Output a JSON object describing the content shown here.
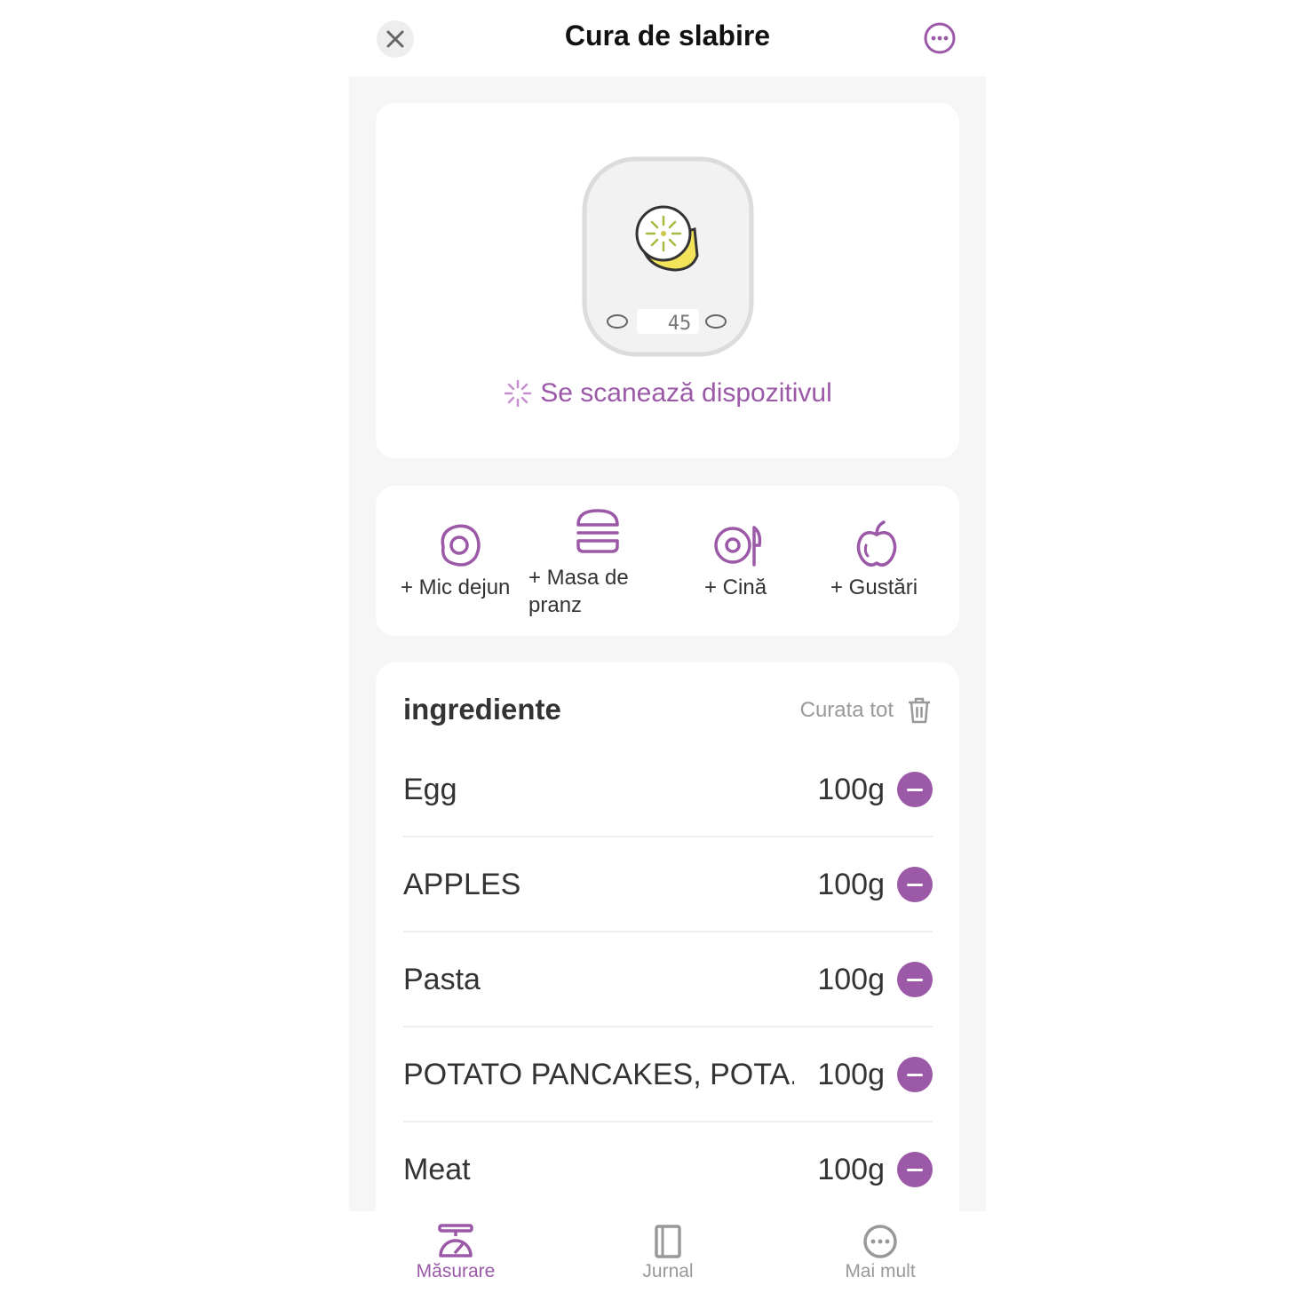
{
  "header": {
    "title": "Cura de slabire"
  },
  "scale": {
    "display_value": "45",
    "status": "Se scanează dispozitivul"
  },
  "meals": [
    {
      "label": "+ Mic dejun",
      "icon": "egg-icon"
    },
    {
      "label": "+ Masa de pranz",
      "icon": "burger-icon"
    },
    {
      "label": "+ Cină",
      "icon": "plate-icon"
    },
    {
      "label": "+ Gustări",
      "icon": "apple-icon"
    }
  ],
  "ingredients": {
    "title": "ingrediente",
    "clear_label": "Curata tot",
    "items": [
      {
        "name": "Egg",
        "amount": "100g"
      },
      {
        "name": "APPLES",
        "amount": "100g"
      },
      {
        "name": "Pasta",
        "amount": "100g"
      },
      {
        "name": "POTATO PANCAKES, POTA...",
        "amount": "100g"
      },
      {
        "name": "Meat",
        "amount": "100g"
      }
    ]
  },
  "tabs": [
    {
      "label": "Măsurare",
      "icon": "scale-icon",
      "active": true
    },
    {
      "label": "Jurnal",
      "icon": "journal-icon",
      "active": false
    },
    {
      "label": "Mai mult",
      "icon": "more-icon",
      "active": false
    }
  ],
  "colors": {
    "accent": "#9b59a8",
    "background": "#f6f6f7"
  }
}
